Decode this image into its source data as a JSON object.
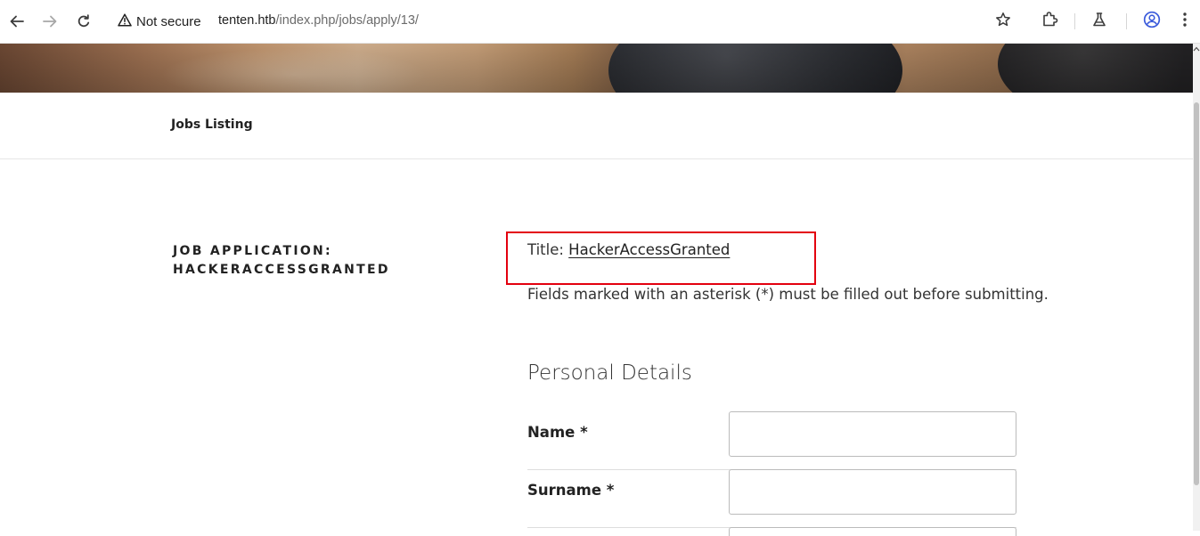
{
  "browser": {
    "security_label": "Not secure",
    "url_host": "tenten.htb",
    "url_path": "/index.php/jobs/apply/13/"
  },
  "site_nav": {
    "jobs_listing": "Jobs Listing"
  },
  "application": {
    "heading": "JOB APPLICATION: HACKERACCESSGRANTED",
    "title_label": "Title: ",
    "title_value": "HackerAccessGranted",
    "required_note": "Fields marked with an asterisk (*) must be filled out before submitting.",
    "section_heading": "Personal Details",
    "fields": [
      {
        "label": "Name *",
        "value": ""
      },
      {
        "label": "Surname *",
        "value": ""
      }
    ]
  },
  "colors": {
    "highlight_border": "#e3000f",
    "text_dark": "#222222",
    "text_body": "#333333"
  }
}
